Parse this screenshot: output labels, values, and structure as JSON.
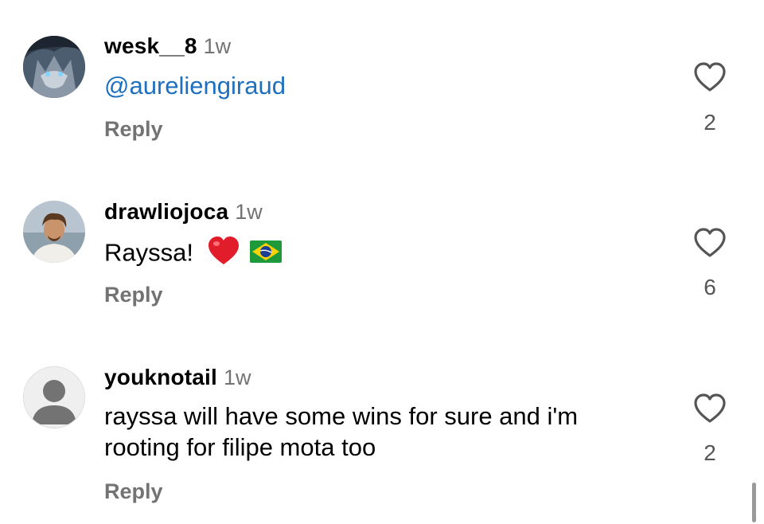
{
  "comments": [
    {
      "username": "wesk__8",
      "time": "1w",
      "mention": "@aureliengiraud",
      "reply_label": "Reply",
      "like_count": "2",
      "avatar_icon": "wolf-avatar-icon"
    },
    {
      "username": "drawliojoca",
      "time": "1w",
      "text": "Rayssa!",
      "emojis": [
        "red-heart-icon",
        "brazil-flag-icon"
      ],
      "reply_label": "Reply",
      "like_count": "6",
      "avatar_icon": "profile-photo-icon"
    },
    {
      "username": "youknotail",
      "time": "1w",
      "text_line1": "rayssa will have some wins for sure and i'm",
      "text_line2": "rooting for filipe mota too",
      "reply_label": "Reply",
      "like_count": "2",
      "avatar_icon": "default-user-icon"
    }
  ],
  "colors": {
    "mention": "#1f6fbf",
    "secondary_text": "#737373",
    "primary_text": "#000000",
    "heart_red": "#e11d2b",
    "flag_green": "#1f9a3a",
    "flag_yellow": "#f5d20a",
    "flag_blue": "#1b3f94"
  }
}
